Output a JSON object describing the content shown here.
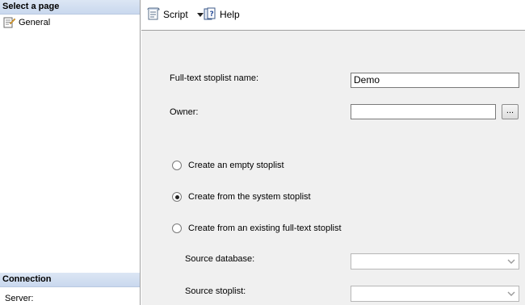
{
  "sidebar": {
    "select_page_header": "Select a page",
    "pages": [
      {
        "label": "General",
        "icon": "page-properties-icon"
      }
    ],
    "connection_header": "Connection",
    "connection_server_label": "Server:"
  },
  "toolbar": {
    "script_label": "Script",
    "help_label": "Help"
  },
  "form": {
    "name_label": "Full-text stoplist name:",
    "name_value": "Demo",
    "owner_label": "Owner:",
    "owner_value": "",
    "browse_label": "...",
    "options": [
      {
        "label": "Create an empty stoplist",
        "checked": false
      },
      {
        "label": "Create from the system stoplist",
        "checked": true
      },
      {
        "label": "Create from an existing full-text stoplist",
        "checked": false
      }
    ],
    "source_database_label": "Source database:",
    "source_database_value": "",
    "source_stoplist_label": "Source stoplist:",
    "source_stoplist_value": ""
  }
}
